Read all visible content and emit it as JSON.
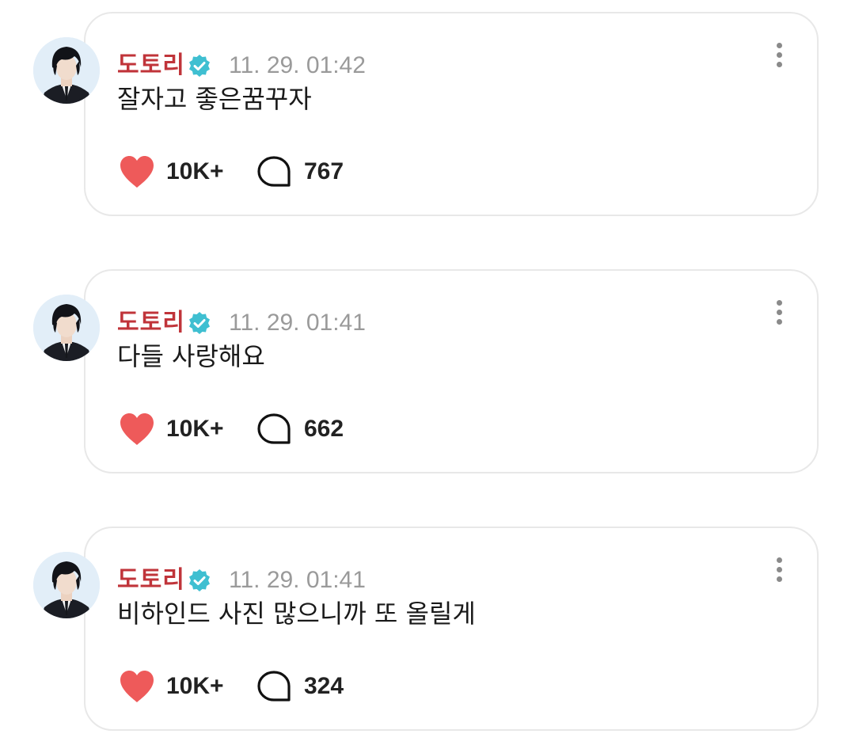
{
  "colors": {
    "author_name": "#c0343a",
    "verified_badge": "#3fbfd1",
    "heart": "#ee5a5a",
    "timestamp": "#9a9a9a",
    "card_border": "#e8e8e8"
  },
  "icons": {
    "verified": "verified-badge-icon",
    "like": "heart-icon",
    "comment": "speech-bubble-icon",
    "more": "vertical-ellipsis-icon"
  },
  "posts": [
    {
      "author": "도토리",
      "timestamp": "11. 29. 01:42",
      "text": "잘자고 좋은꿈꾸자",
      "likes": "10K+",
      "comments": "767"
    },
    {
      "author": "도토리",
      "timestamp": "11. 29. 01:41",
      "text": "다들 사랑해요",
      "likes": "10K+",
      "comments": "662"
    },
    {
      "author": "도토리",
      "timestamp": "11. 29. 01:41",
      "text": "비하인드 사진 많으니까 또 올릴게",
      "likes": "10K+",
      "comments": "324"
    }
  ]
}
